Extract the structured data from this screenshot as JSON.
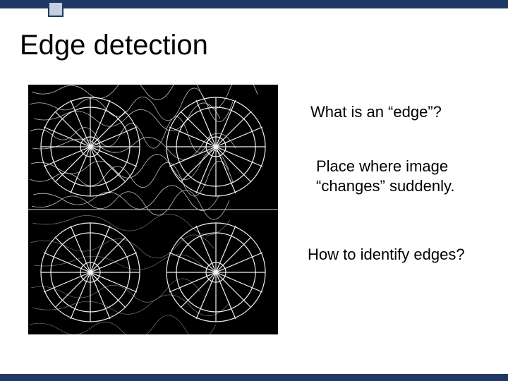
{
  "title": "Edge detection",
  "text": {
    "q1": "What is an “edge”?",
    "p1_line1": "Place where image",
    "p1_line2": "“changes” suddenly.",
    "q2": "How to identify edges?"
  }
}
